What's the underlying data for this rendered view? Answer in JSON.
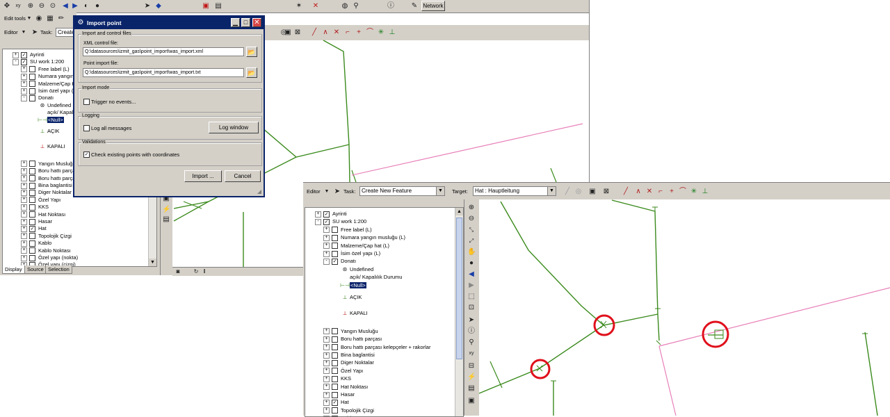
{
  "back": {
    "main_toolbar_label": "Network",
    "edit_tools_label": "Edit tools",
    "editor_label": "Editor",
    "task_label": "Task:",
    "task_value": "Create",
    "toc_items": [
      {
        "label": "Ayrinti",
        "checked": true,
        "indent": 0,
        "expander": "+"
      },
      {
        "label": "SU work 1:200",
        "checked": true,
        "indent": 0,
        "expander": "-"
      },
      {
        "label": "Free label (L)",
        "checked": false,
        "indent": 1,
        "expander": "+"
      },
      {
        "label": "Numara yangın",
        "checked": false,
        "indent": 1,
        "expander": "+"
      },
      {
        "label": "Malzeme/Çap H",
        "checked": false,
        "indent": 1,
        "expander": "+"
      },
      {
        "label": "İsim özel yapı (",
        "checked": false,
        "indent": 1,
        "expander": "+"
      },
      {
        "label": "Donatı",
        "checked": false,
        "indent": 1,
        "expander": "-"
      }
    ],
    "toc_sub": {
      "undefined": "Undefined",
      "acik_kapali": "açık/ Kapalı",
      "null": "<Null>",
      "acik": "AÇIK",
      "kapali": "KAPALI"
    },
    "toc_items2": [
      {
        "label": "Yangın Musluğu",
        "checked": false
      },
      {
        "label": "Boru hattı parça",
        "checked": false
      },
      {
        "label": "Boru hattı parça",
        "checked": false
      },
      {
        "label": "Bina baglantisi",
        "checked": false
      },
      {
        "label": "Diger Noktalar",
        "checked": false
      },
      {
        "label": "Özel Yapı",
        "checked": false
      },
      {
        "label": "KKS",
        "checked": false
      },
      {
        "label": "Hat Noktası",
        "checked": false
      },
      {
        "label": "Hasar",
        "checked": false
      },
      {
        "label": "Hat",
        "checked": true
      },
      {
        "label": "Topolojik Çizgi",
        "checked": false
      },
      {
        "label": "Kablo",
        "checked": false
      },
      {
        "label": "Kablo Noktası",
        "checked": false
      },
      {
        "label": "Özel yapı (nokta)",
        "checked": false
      },
      {
        "label": "Özel yapı (çizgi)",
        "checked": false
      }
    ],
    "tabs": [
      "Display",
      "Source",
      "Selection"
    ]
  },
  "dialog": {
    "title": "Import point",
    "group1_label": "Import and control files",
    "xml_label": "XML control file:",
    "xml_value": "Q:\\datasources\\izmit_gas\\point_import\\was_import.xml",
    "point_label": "Point import file:",
    "point_value": "Q:\\datasources\\izmit_gas\\point_import\\was_import.txt",
    "group2_label": "Import mode",
    "trigger_label": "Trigger no events...",
    "trigger_checked": false,
    "group3_label": "Logging",
    "log_all_label": "Log all messages",
    "log_all_checked": false,
    "log_window_button": "Log window",
    "group4_label": "Validations",
    "check_label": "Check existing points with coordinates",
    "check_checked": true,
    "import_button": "Import ...",
    "cancel_button": "Cancel"
  },
  "front": {
    "editor_label": "Editor",
    "task_label": "Task:",
    "task_value": "Create New Feature",
    "target_label": "Target:",
    "target_value": "Hat : Hauptleitung",
    "toc_items": [
      {
        "label": "Ayrinti",
        "checked": true,
        "indent": 0,
        "expander": "+"
      },
      {
        "label": "SU work 1:200",
        "checked": true,
        "indent": 0,
        "expander": "-"
      },
      {
        "label": "Free label (L)",
        "checked": false,
        "indent": 1,
        "expander": "+"
      },
      {
        "label": "Numara yangın musluğu (L)",
        "checked": false,
        "indent": 1,
        "expander": "+"
      },
      {
        "label": "Malzeme/Çap hat (L)",
        "checked": false,
        "indent": 1,
        "expander": "+"
      },
      {
        "label": "İsim özel yapı (L)",
        "checked": false,
        "indent": 1,
        "expander": "+"
      },
      {
        "label": "Donatı",
        "checked": true,
        "indent": 1,
        "expander": "-"
      }
    ],
    "toc_sub": {
      "undefined": "Undefined",
      "acik_kapali": "açık/ Kapalılık Durumu",
      "null": "<Null>",
      "acik": "AÇIK",
      "kapali": "KAPALI"
    },
    "toc_items2": [
      {
        "label": "Yangın Musluğu",
        "checked": false
      },
      {
        "label": "Boru hattı parçası",
        "checked": false
      },
      {
        "label": "Boru hattı parçası kelepçeler + rakorlar",
        "checked": false
      },
      {
        "label": "Bina baglantisi",
        "checked": false
      },
      {
        "label": "Diger Noktalar",
        "checked": false
      },
      {
        "label": "Özel Yapı",
        "checked": false
      },
      {
        "label": "KKS",
        "checked": false
      },
      {
        "label": "Hat Noktası",
        "checked": false
      },
      {
        "label": "Hasar",
        "checked": false
      },
      {
        "label": "Hat",
        "checked": true
      },
      {
        "label": "Topolojik Çizgi",
        "checked": false
      },
      {
        "label": "Kablo",
        "checked": false
      }
    ]
  },
  "colors": {
    "pipe": "#3a8a1c",
    "boundary": "#e87fb8",
    "highlight": "#e0101c",
    "titlebar": "#0a246a",
    "selection": "#0a246a"
  }
}
